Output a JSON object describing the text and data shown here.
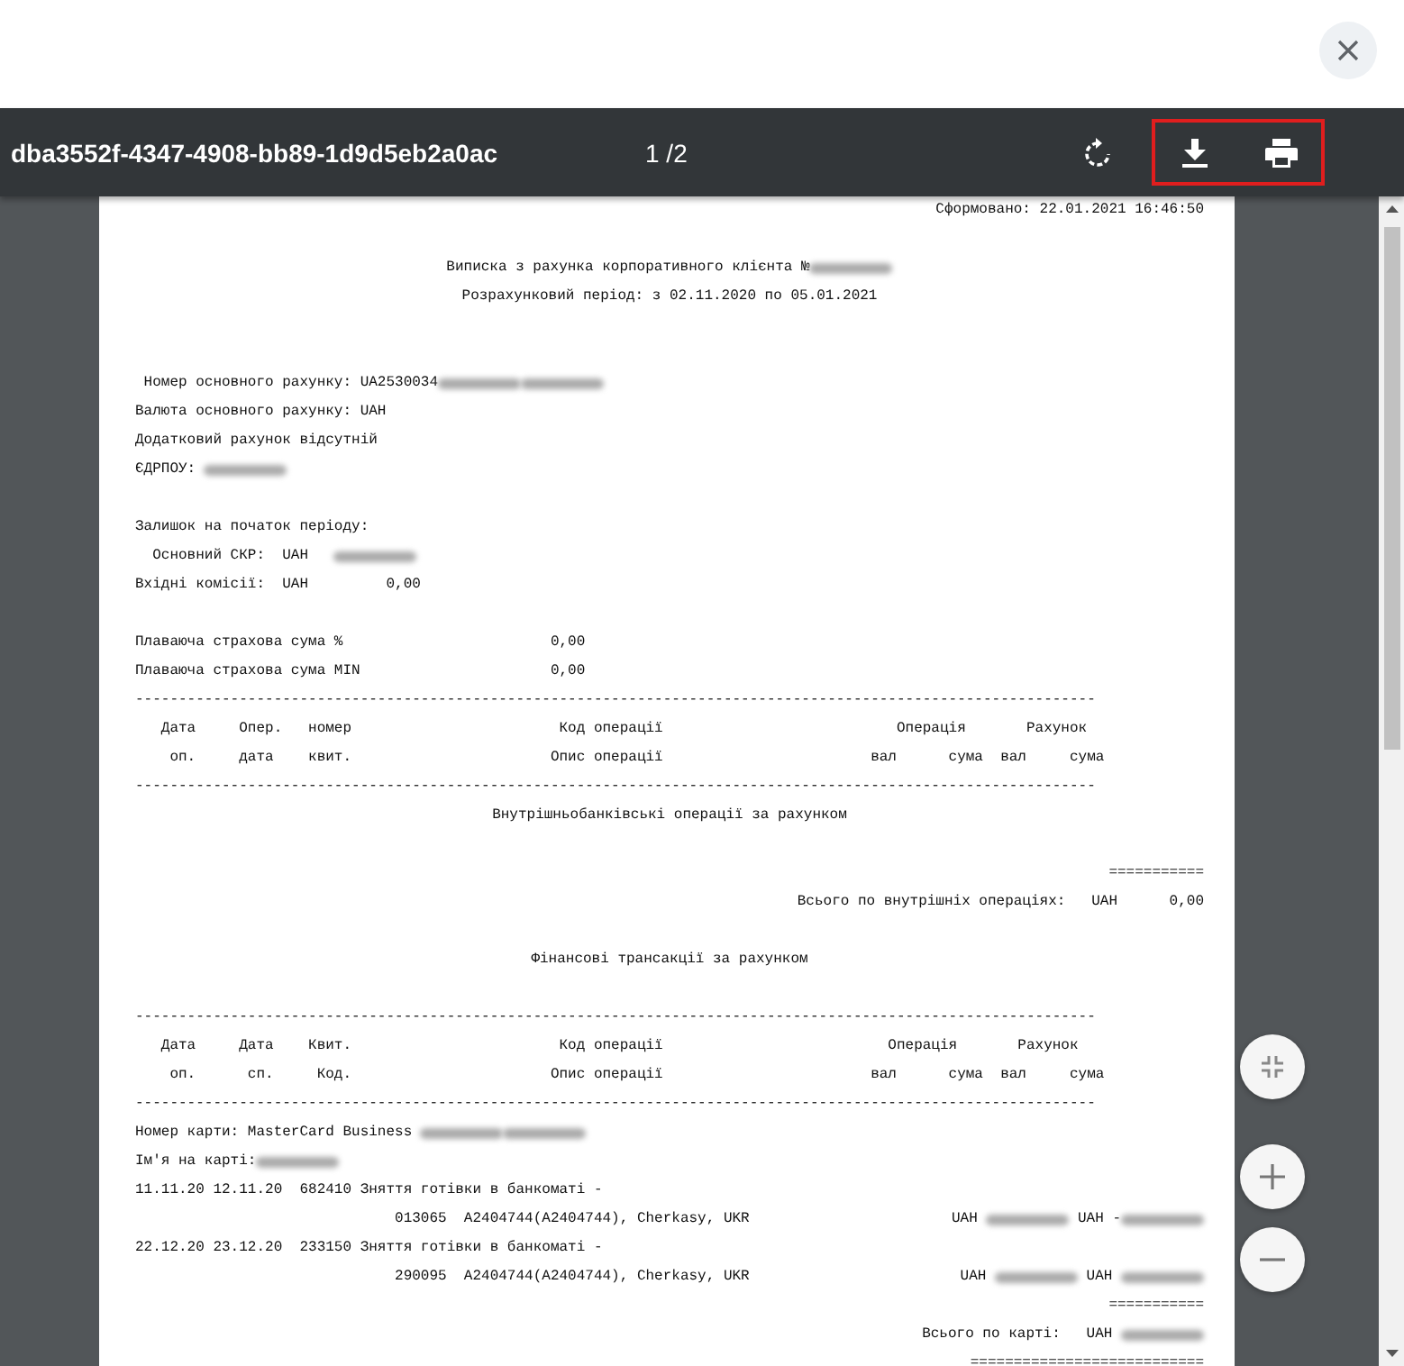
{
  "toolbar": {
    "title": "dba3552f-4347-4908-bb89-1d9d5eb2a0ac",
    "page_indicator": "1 /2"
  },
  "document": {
    "lines": [
      {
        "kind": "right",
        "segments": [
          {
            "kind": "text",
            "text": "Сформовано: 22.01.2021 16:46:50"
          }
        ]
      },
      {
        "kind": "blank"
      },
      {
        "kind": "center",
        "segments": [
          {
            "kind": "text",
            "text": "Виписка з рахунка корпоративного клієнта №"
          },
          {
            "kind": "redacted"
          }
        ]
      },
      {
        "kind": "center",
        "segments": [
          {
            "kind": "text",
            "text": "Розрахунковий період: з 02.11.2020 по 05.01.2021"
          }
        ]
      },
      {
        "kind": "blank"
      },
      {
        "kind": "blank"
      },
      {
        "kind": "left",
        "segments": [
          {
            "kind": "text",
            "text": " Номер основного рахунку: UA2530034"
          },
          {
            "kind": "redacted"
          },
          {
            "kind": "redacted"
          }
        ]
      },
      {
        "kind": "left",
        "segments": [
          {
            "kind": "text",
            "text": "Валюта основного рахунку: UAH"
          }
        ]
      },
      {
        "kind": "left",
        "segments": [
          {
            "kind": "text",
            "text": "Додатковий рахунок відсутній"
          }
        ]
      },
      {
        "kind": "left",
        "segments": [
          {
            "kind": "text",
            "text": "ЄДРПОУ: "
          },
          {
            "kind": "redacted"
          }
        ]
      },
      {
        "kind": "blank"
      },
      {
        "kind": "left",
        "segments": [
          {
            "kind": "text",
            "text": "Залишок на початок періоду:"
          }
        ]
      },
      {
        "kind": "left",
        "segments": [
          {
            "kind": "text",
            "text": "  Основний СКР:  UAH   "
          },
          {
            "kind": "redacted"
          }
        ]
      },
      {
        "kind": "left",
        "segments": [
          {
            "kind": "text",
            "text": "Вхідні комісії:  UAH         0,00"
          }
        ]
      },
      {
        "kind": "blank"
      },
      {
        "kind": "left",
        "segments": [
          {
            "kind": "text",
            "text": "Плаваюча страхова сума %                        0,00"
          }
        ]
      },
      {
        "kind": "left",
        "segments": [
          {
            "kind": "text",
            "text": "Плаваюча страхова сума MIN                      0,00"
          }
        ]
      },
      {
        "kind": "left",
        "segments": [
          {
            "kind": "text",
            "text": "---------------------------------------------------------------------------------------------------------------"
          }
        ]
      },
      {
        "kind": "left",
        "segments": [
          {
            "kind": "text",
            "text": "   Дата     Опер.   номер                        Код операції                           Операція       Рахунок"
          }
        ]
      },
      {
        "kind": "left",
        "segments": [
          {
            "kind": "text",
            "text": "    оп.     дата    квит.                       Опис операції                        вал      сума  вал     сума"
          }
        ]
      },
      {
        "kind": "left",
        "segments": [
          {
            "kind": "text",
            "text": "---------------------------------------------------------------------------------------------------------------"
          }
        ]
      },
      {
        "kind": "center",
        "segments": [
          {
            "kind": "text",
            "text": "Внутрішньобанківські операції за рахунком"
          }
        ]
      },
      {
        "kind": "blank"
      },
      {
        "kind": "right",
        "segments": [
          {
            "kind": "text",
            "text": "==========="
          }
        ]
      },
      {
        "kind": "right",
        "segments": [
          {
            "kind": "text",
            "text": "Всього по внутрішніх операціях:   UAH      0,00"
          }
        ]
      },
      {
        "kind": "blank"
      },
      {
        "kind": "center",
        "segments": [
          {
            "kind": "text",
            "text": "Фінансові трансакції за рахунком"
          }
        ]
      },
      {
        "kind": "blank"
      },
      {
        "kind": "left",
        "segments": [
          {
            "kind": "text",
            "text": "---------------------------------------------------------------------------------------------------------------"
          }
        ]
      },
      {
        "kind": "left",
        "segments": [
          {
            "kind": "text",
            "text": "   Дата     Дата    Квит.                        Код операції                          Операція       Рахунок"
          }
        ]
      },
      {
        "kind": "left",
        "segments": [
          {
            "kind": "text",
            "text": "    оп.      сп.     Код.                       Опис операції                        вал      сума  вал     сума"
          }
        ]
      },
      {
        "kind": "left",
        "segments": [
          {
            "kind": "text",
            "text": "---------------------------------------------------------------------------------------------------------------"
          }
        ]
      },
      {
        "kind": "left",
        "segments": [
          {
            "kind": "text",
            "text": "Номер карти: MasterCard Business "
          },
          {
            "kind": "redacted"
          },
          {
            "kind": "redacted"
          }
        ]
      },
      {
        "kind": "left",
        "segments": [
          {
            "kind": "text",
            "text": "Ім'я на карті:"
          },
          {
            "kind": "redacted"
          }
        ]
      },
      {
        "kind": "left",
        "segments": [
          {
            "kind": "text",
            "text": "11.11.20 12.11.20  682410 Зняття готівки в банкоматі -"
          }
        ]
      },
      {
        "kind": "split",
        "segments": [
          {
            "kind": "text",
            "text": "                              013065  A2404744(A2404744), Cherkasy, UKR"
          }
        ],
        "trailing": [
          {
            "kind": "text",
            "text": "UAH "
          },
          {
            "kind": "redacted"
          },
          {
            "kind": "text",
            "text": " UAH -"
          },
          {
            "kind": "redacted"
          }
        ]
      },
      {
        "kind": "left",
        "segments": [
          {
            "kind": "text",
            "text": "22.12.20 23.12.20  233150 Зняття готівки в банкоматі -"
          }
        ]
      },
      {
        "kind": "split",
        "segments": [
          {
            "kind": "text",
            "text": "                              290095  A2404744(A2404744), Cherkasy, UKR"
          }
        ],
        "trailing": [
          {
            "kind": "text",
            "text": "UAH "
          },
          {
            "kind": "redacted"
          },
          {
            "kind": "text",
            "text": " UAH "
          },
          {
            "kind": "redacted"
          }
        ]
      },
      {
        "kind": "right",
        "segments": [
          {
            "kind": "text",
            "text": "==========="
          }
        ]
      },
      {
        "kind": "right",
        "segments": [
          {
            "kind": "text",
            "text": "Всього по карті:   UAH "
          },
          {
            "kind": "redacted"
          }
        ]
      },
      {
        "kind": "right",
        "segments": [
          {
            "kind": "text",
            "text": "==========================="
          }
        ]
      }
    ]
  }
}
